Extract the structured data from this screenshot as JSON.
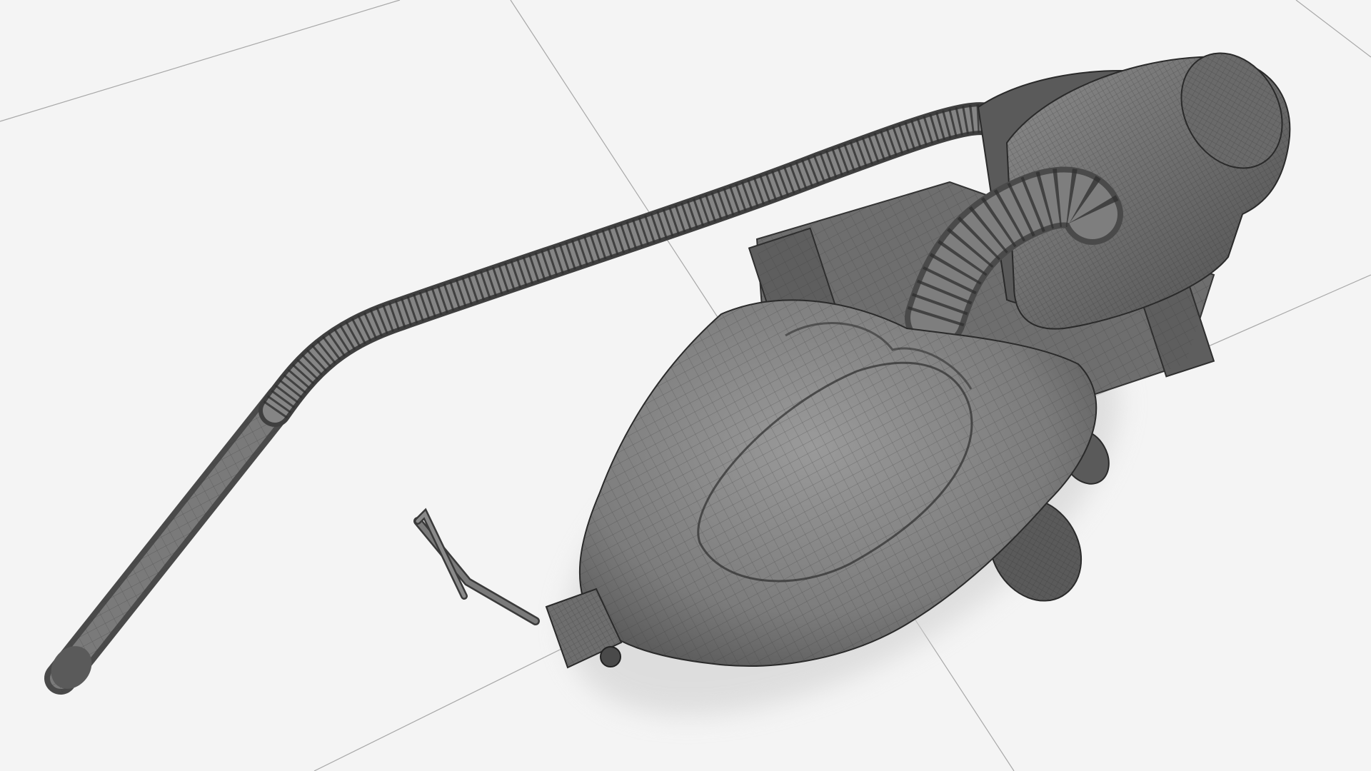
{
  "scene": {
    "subject": "vacuum-cleaner-wireframe-render",
    "colors": {
      "background": "#f4f4f4",
      "floor_line": "#9a9a9a",
      "body_fill": "#8a8a8a",
      "body_dark": "#5c5c5c",
      "wire": "#3a3a3a",
      "shadow": "#d6d6d6"
    }
  }
}
